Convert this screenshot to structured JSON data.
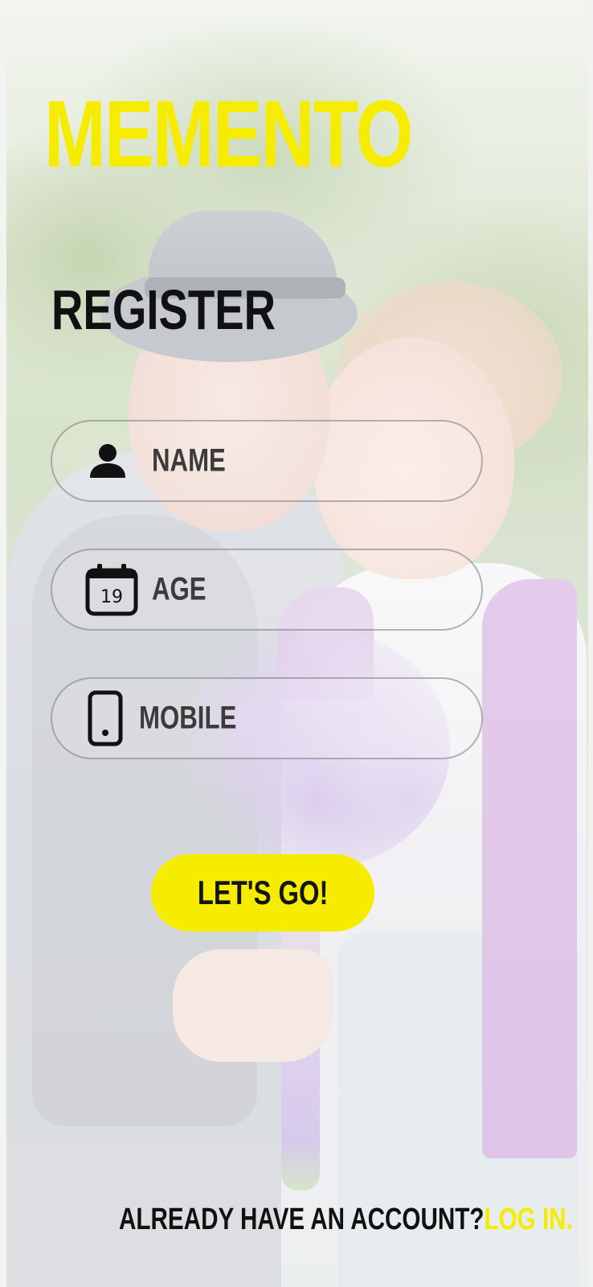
{
  "app": {
    "brand": "MEMENTO"
  },
  "screen": {
    "heading": "REGISTER"
  },
  "form": {
    "fields": [
      {
        "label": "NAME",
        "icon": "person-icon"
      },
      {
        "label": "AGE",
        "icon": "calendar-icon",
        "icon_text": "19"
      },
      {
        "label": "MOBILE",
        "icon": "smartphone-icon"
      }
    ],
    "submit_label": "LET'S GO!"
  },
  "footer": {
    "question": "ALREADY HAVE AN ACCOUNT?",
    "login_link": "LOG IN."
  },
  "colors": {
    "accent": "#F5EC00",
    "text_dark": "#111111",
    "field_border": "#8A8A8A"
  }
}
